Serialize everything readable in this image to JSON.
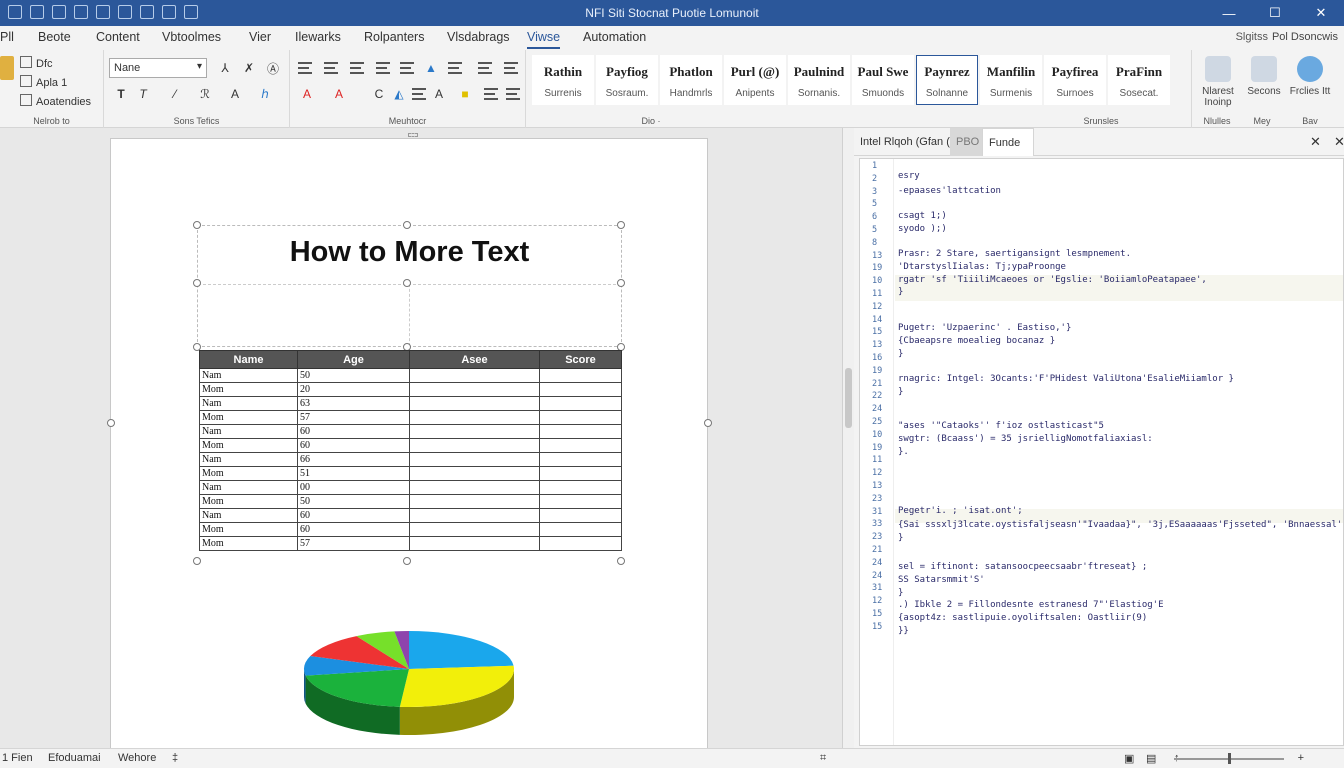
{
  "titlebar": {
    "title": "NFI Siti Stocnat Puotie Lomunoit"
  },
  "tabs": [
    {
      "label": "Pll"
    },
    {
      "label": "Beote"
    },
    {
      "label": "Content"
    },
    {
      "label": "Vbtoolmes"
    },
    {
      "label": "Vier"
    },
    {
      "label": "Ilewarks"
    },
    {
      "label": "Rolpanters"
    },
    {
      "label": "Vlsdabrags"
    },
    {
      "label": "Viwse"
    },
    {
      "label": "Automation"
    }
  ],
  "active_tab": "Viwse",
  "share_label": "Slgitss",
  "account_label": "Pol Dsoncwis",
  "ribbon": {
    "clipboard": {
      "items": [
        "Dfc",
        "Apla 1",
        "Aoatendies"
      ],
      "label": "Nelrob to"
    },
    "font": {
      "font_name": "Nane",
      "label": "Sons Tefics"
    },
    "paragraph": {
      "label": "Meuhtocr"
    },
    "styles_label": "Dio ·",
    "styles": [
      {
        "title": "Rathin",
        "sub": "Surrenis"
      },
      {
        "title": "Payfiog",
        "sub": "Sosraum."
      },
      {
        "title": "Phatlon",
        "sub": "Handmrls"
      },
      {
        "title": "Purl (@)",
        "sub": "Anipents"
      },
      {
        "title": "Paulnind",
        "sub": "Sornanis."
      },
      {
        "title": "Paul Swe",
        "sub": "Smuonds"
      },
      {
        "title": "Paynrez",
        "sub": "Solnanne"
      },
      {
        "title": "Manfilin",
        "sub": "Surmenis"
      },
      {
        "title": "Payfirea",
        "sub": "Surnoes"
      },
      {
        "title": "PraFinn",
        "sub": "Sosecat."
      }
    ],
    "styles_group_label": "Srunsles",
    "editing": [
      {
        "label": "Nlarest Inoinp"
      },
      {
        "label": "Secons"
      },
      {
        "label": "Frclies Itt"
      }
    ],
    "editing_labels": [
      "Nlulles",
      "Mey",
      "Bav"
    ]
  },
  "document": {
    "heading": "How to More Text",
    "table": {
      "headers": [
        "Name",
        "Age",
        "Asee",
        "Score"
      ],
      "rows": [
        [
          "Nam",
          "50",
          "",
          ""
        ],
        [
          "Mom",
          "20",
          "",
          ""
        ],
        [
          "Nam",
          "63",
          "",
          ""
        ],
        [
          "Mom",
          "57",
          "",
          ""
        ],
        [
          "Nam",
          "60",
          "",
          ""
        ],
        [
          "Mom",
          "60",
          "",
          ""
        ],
        [
          "Nam",
          "66",
          "",
          ""
        ],
        [
          "Mom",
          "51",
          "",
          ""
        ],
        [
          "Nam",
          "00",
          "",
          ""
        ],
        [
          "Mom",
          "50",
          "",
          ""
        ],
        [
          "Nam",
          "60",
          "",
          ""
        ],
        [
          "Mom",
          "60",
          "",
          ""
        ],
        [
          "Mom",
          "57",
          "",
          ""
        ]
      ]
    },
    "pie_colors": [
      "#1aa7ec",
      "#f2ef0a",
      "#1bb23c",
      "#1c8fe0",
      "#ee3333",
      "#76e02a",
      "#8e44ad"
    ]
  },
  "pane": {
    "tabs": [
      "Intel Rlqoh (Gfan ()",
      "PBO",
      "Funde"
    ],
    "active_tab": "Funde",
    "line_numbers": [
      "1",
      "2",
      "3",
      "5",
      "6",
      "5",
      "8",
      "13",
      "19",
      "10",
      "11",
      "12",
      "14",
      "15",
      "13",
      "16",
      "19",
      "21",
      "22",
      "24",
      "25",
      "10",
      "19",
      "11",
      "12",
      "13",
      "23",
      "31",
      "33",
      "23",
      "21",
      "24",
      "24",
      "31",
      "12",
      "15",
      "15"
    ],
    "code_lines": [
      "esry",
      "-epaases'lattcation",
      "csagt 1;)",
      "syodo );)",
      "Prasr:  2 Stare, saertigansignt lesmpnement.",
      "'DtarstyslIialas: Tj;ypaProonge",
      "rgatr  'sf  'TiiiliMcaeoes  or  'Egslie:  'BoiiamloPeatapaee',",
      "}",
      "Pugetr:  'Uzpaerinc' . Eastiso,'}",
      "{Cbaeapsre moealieg bocanaz }",
      "}",
      "rnagric:   Intgel:  3Ocants:'F'PHidest ValiUtona'EsalieMiiamlor }",
      "}",
      "\"ases  '\"Cataoks''  f'ioz  ostlasticast\"5",
      " swgtr:  (Bcaass')  =  35  jsrielligNomotfaliaxiasl:",
      "}.",
      "Pegetr'i. ;  'isat.ont';",
      "{Sai  sssxlj3lcate.oystisfaljseasn'\"Ivaadaa}\",  '3j,ESaaaaaas'Fjsseted\",  'Bnnaessal'",
      "}",
      "sel  =  iftinont:  satansoocpeecsaabr'ftreseat}  ;",
      " SS  Satarsmmit'S'",
      "}",
      ".)   Ibkle  2  =  Fillondesnte  estranesd  7\"'Elastiog'E",
      " {asopt4z:  sastlipuie.oyoliftsalen:  Oastliir(9)",
      "}}"
    ]
  },
  "status": {
    "page": "1 Fien",
    "words": "Efoduamai",
    "lang": "Wehore",
    "extra": "‡"
  }
}
